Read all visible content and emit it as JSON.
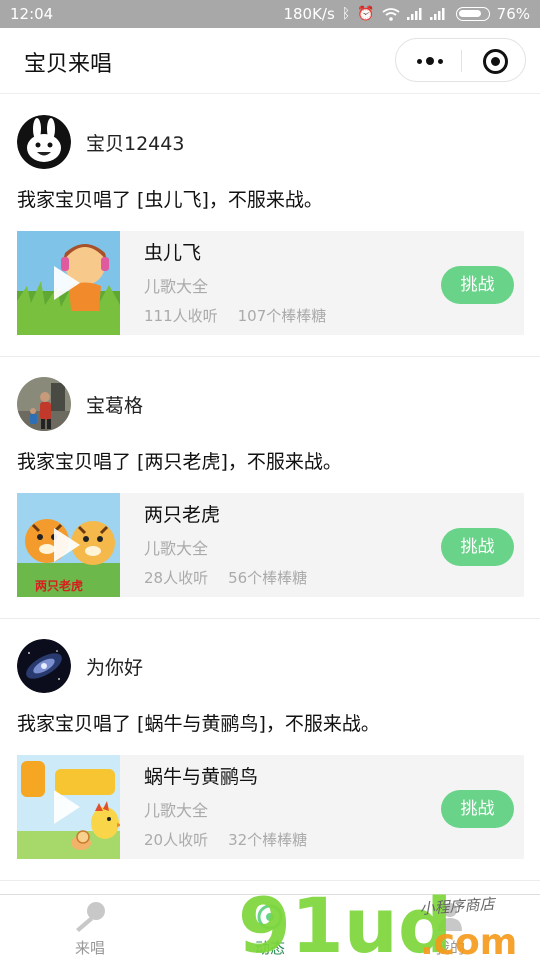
{
  "status_bar": {
    "time": "12:04",
    "speed": "180K/s",
    "battery": "76%"
  },
  "title_bar": {
    "title": "宝贝来唱"
  },
  "posts": [
    {
      "username": "宝贝12443",
      "text": "我家宝贝唱了 [虫儿飞]，不服来战。",
      "song": "虫儿飞",
      "album": "儿歌大全",
      "listeners": "111人收听",
      "candies": "107个棒棒糖",
      "button": "挑战"
    },
    {
      "username": "宝葛格",
      "text": "我家宝贝唱了 [两只老虎]，不服来战。",
      "song": "两只老虎",
      "album": "儿歌大全",
      "listeners": "28人收听",
      "candies": "56个棒棒糖",
      "button": "挑战",
      "thumb_caption": "两只老虎"
    },
    {
      "username": "为你好",
      "text": "我家宝贝唱了 [蜗牛与黄鹂鸟]，不服来战。",
      "song": "蜗牛与黄鹂鸟",
      "album": "儿歌大全",
      "listeners": "20人收听",
      "candies": "32个棒棒糖",
      "button": "挑战"
    }
  ],
  "tab_bar": {
    "tabs": [
      {
        "label": "来唱",
        "icon": "microphone-icon"
      },
      {
        "label": "动态",
        "icon": "feed-icon"
      },
      {
        "label": "我的",
        "icon": "user-icon"
      }
    ]
  },
  "watermark": {
    "brand": "91ud",
    "domain": ".com",
    "slogan": "小程序商店"
  },
  "colors": {
    "accent": "#6ad38a",
    "status_bar": "#a8a8a8",
    "muted_text": "#aaaaaa"
  }
}
